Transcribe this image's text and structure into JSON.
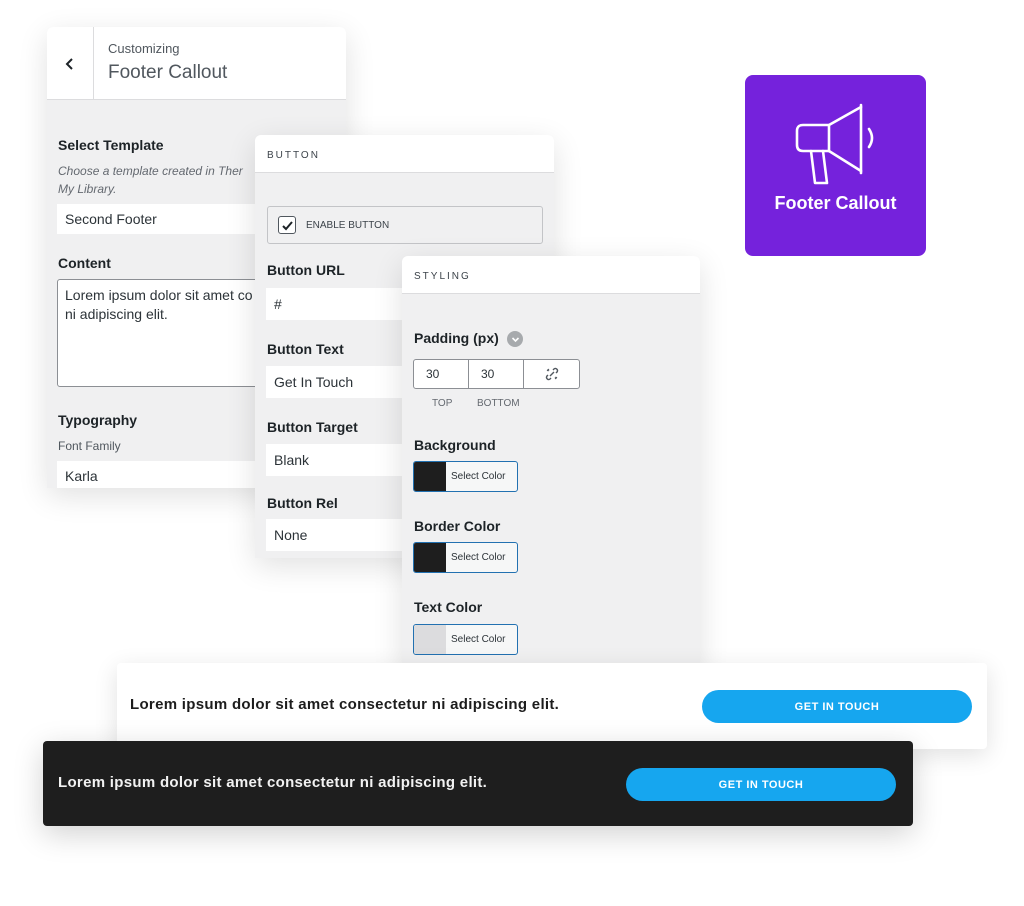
{
  "customizer": {
    "subtitle": "Customizing",
    "title": "Footer Callout",
    "select_template_label": "Select Template",
    "select_template_desc_line1": "Choose a template created in Ther",
    "select_template_desc_line2": "My Library.",
    "template_value": "Second Footer",
    "content_label": "Content",
    "content_line1": "Lorem ipsum dolor sit amet co",
    "content_line2": "ni adipiscing elit.",
    "typography_label": "Typography",
    "font_family_label": "Font Family",
    "font_family_value": "Karla"
  },
  "button_panel": {
    "header": "BUTTON",
    "enable_label": "ENABLE BUTTON",
    "enable_checked": true,
    "url_label": "Button URL",
    "url_value": "#",
    "text_label": "Button Text",
    "text_value": "Get In Touch",
    "target_label": "Button Target",
    "target_value": "Blank",
    "rel_label": "Button Rel",
    "rel_value": "None"
  },
  "styling_panel": {
    "header": "STYLING",
    "padding_label": "Padding (px)",
    "padding_top": "30",
    "padding_bottom": "30",
    "top_caption": "TOP",
    "bottom_caption": "BOTTOM",
    "background_label": "Background",
    "background_color": "#1e1e1e",
    "background_btn": "Select Color",
    "border_label": "Border Color",
    "border_color": "#1e1e1e",
    "border_btn": "Select Color",
    "text_color_label": "Text Color",
    "text_color": "#dcdcde",
    "text_btn": "Select Color"
  },
  "badge": {
    "label": "Footer Callout",
    "icon": "megaphone-icon",
    "color": "#7522dc"
  },
  "preview_light": {
    "text": "Lorem ipsum dolor sit amet consectetur ni adipiscing elit.",
    "button": "GET IN TOUCH"
  },
  "preview_dark": {
    "text": "Lorem ipsum dolor sit amet consectetur ni adipiscing elit.",
    "button": "GET IN TOUCH"
  },
  "accent_color": "#16a6ef"
}
